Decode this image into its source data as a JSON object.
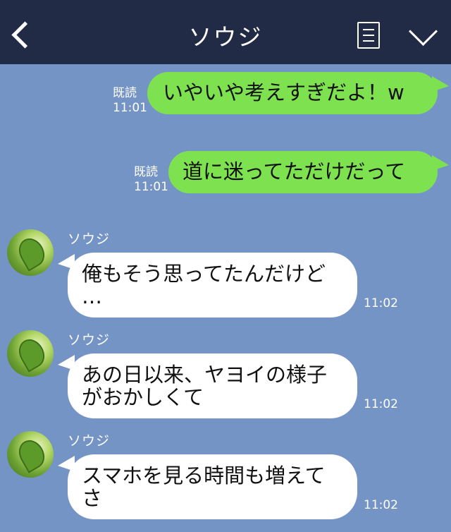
{
  "header": {
    "title": "ソウジ",
    "back_icon": "back-chevron-icon",
    "menu_icon": "menu-document-icon",
    "collapse_icon": "chevron-down-icon"
  },
  "messages": [
    {
      "direction": "out",
      "read": "既読",
      "time": "11:01",
      "lines": [
        "いやいや考えすぎだよ！w"
      ]
    },
    {
      "direction": "out",
      "read": "既読",
      "time": "11:01",
      "lines": [
        "道に迷ってただけだって"
      ]
    },
    {
      "direction": "in",
      "sender": "ソウジ",
      "time": "11:02",
      "lines": [
        "俺もそう思ってたんだけど",
        "…"
      ]
    },
    {
      "direction": "in",
      "sender": "ソウジ",
      "time": "11:02",
      "lines": [
        "あの日以来、ヤヨイの様子",
        "がおかしくて"
      ]
    },
    {
      "direction": "in",
      "sender": "ソウジ",
      "time": "11:02",
      "lines": [
        "スマホを見る時間も増えて",
        "さ"
      ]
    }
  ],
  "colors": {
    "header_bg": "#222b45",
    "chat_bg": "#7594c6",
    "outgoing_bubble": "#7ee250",
    "incoming_bubble": "#ffffff"
  }
}
